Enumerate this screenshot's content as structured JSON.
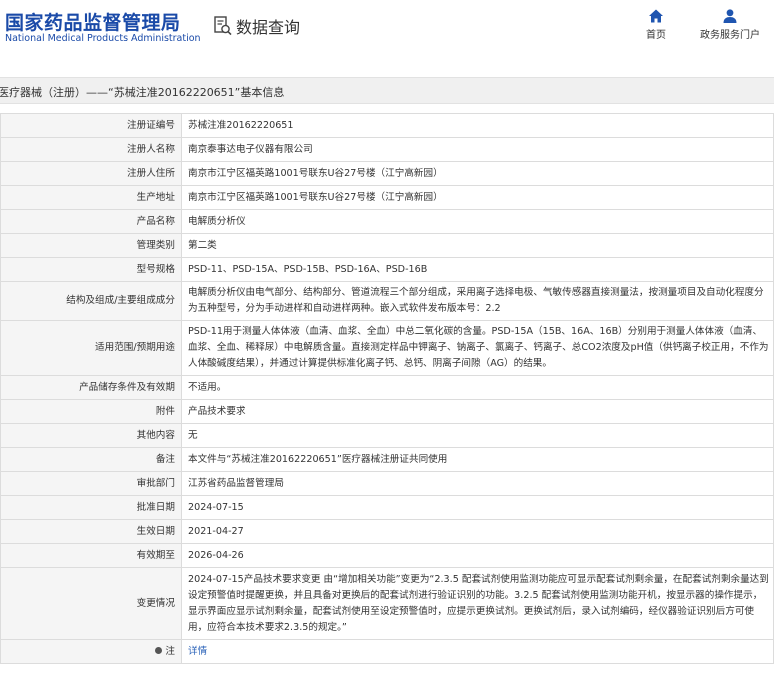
{
  "header": {
    "logo_cn": "国家药品监督管理局",
    "logo_en": "National Medical Products Administration",
    "query_label": "数据查询",
    "nav": [
      {
        "label": "首页",
        "icon": "home-icon"
      },
      {
        "label": "政务服务门户",
        "icon": "user-icon"
      }
    ]
  },
  "breadcrumb": "医疗器械（注册）——“苏械注准20162220651”基本信息",
  "rows": [
    {
      "label": "注册证编号",
      "value": "苏械注准20162220651"
    },
    {
      "label": "注册人名称",
      "value": "南京泰事达电子仪器有限公司"
    },
    {
      "label": "注册人住所",
      "value": "南京市江宁区福英路1001号联东U谷27号楼（江宁高新园）"
    },
    {
      "label": "生产地址",
      "value": "南京市江宁区福英路1001号联东U谷27号楼（江宁高新园）"
    },
    {
      "label": "产品名称",
      "value": "电解质分析仪"
    },
    {
      "label": "管理类别",
      "value": "第二类"
    },
    {
      "label": "型号规格",
      "value": "PSD-11、PSD-15A、PSD-15B、PSD-16A、PSD-16B"
    },
    {
      "label": "结构及组成/主要组成成分",
      "value": "电解质分析仪由电气部分、结构部分、管道流程三个部分组成，采用离子选择电极、气敏传感器直接测量法，按测量项目及自动化程度分为五种型号，分为手动进样和自动进样两种。嵌入式软件发布版本号：2.2"
    },
    {
      "label": "适用范围/预期用途",
      "value": "PSD-11用于测量人体体液（血清、血浆、全血）中总二氧化碳的含量。PSD-15A（15B、16A、16B）分别用于测量人体体液（血清、血浆、全血、稀释尿）中电解质含量。直接测定样品中钾离子、钠离子、氯离子、钙离子、总CO2浓度及pH值（供钙离子校正用，不作为人体酸碱度结果），并通过计算提供标准化离子钙、总钙、阴离子间隙（AG）的结果。"
    },
    {
      "label": "产品储存条件及有效期",
      "value": "不适用。"
    },
    {
      "label": "附件",
      "value": "产品技术要求"
    },
    {
      "label": "其他内容",
      "value": "无"
    },
    {
      "label": "备注",
      "value": "本文件与“苏械注准20162220651”医疗器械注册证共同使用"
    },
    {
      "label": "审批部门",
      "value": "江苏省药品监督管理局"
    },
    {
      "label": "批准日期",
      "value": "2024-07-15"
    },
    {
      "label": "生效日期",
      "value": "2021-04-27"
    },
    {
      "label": "有效期至",
      "value": "2026-04-26"
    },
    {
      "label": "变更情况",
      "value": "2024-07-15产品技术要求变更 由“增加相关功能”变更为“2.3.5 配套试剂使用监测功能应可显示配套试剂剩余量，在配套试剂剩余量达到设定预警值时提醒更换，并且具备对更换后的配套试剂进行验证识别的功能。3.2.5 配套试剂使用监测功能开机，按显示器的操作提示，显示界面应显示试剂剩余量，配套试剂使用至设定预警值时，应提示更换试剂。更换试剂后，录入试剂编码，经仪器验证识别后方可使用，应符合本技术要求2.3.5的规定。”"
    }
  ],
  "note_row": {
    "label": "注",
    "link": "详情"
  }
}
